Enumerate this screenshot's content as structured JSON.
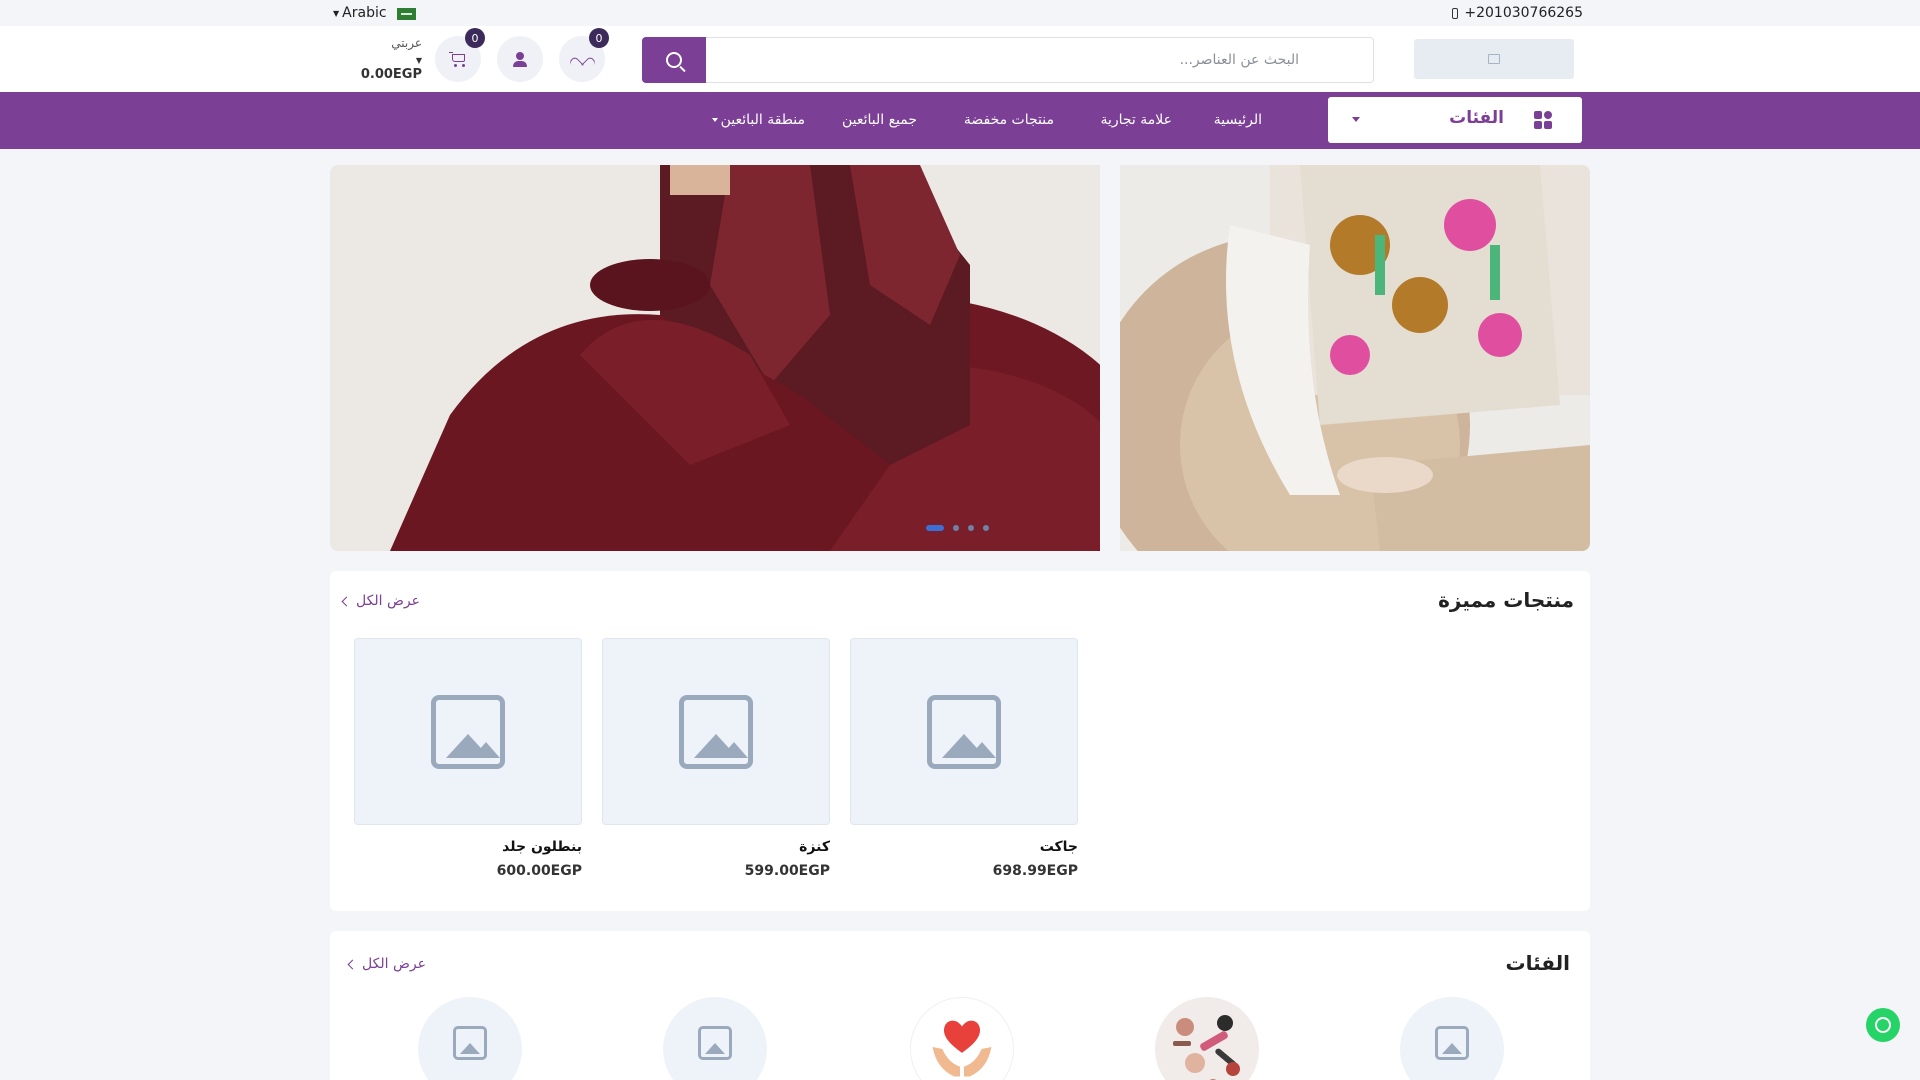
{
  "topbar": {
    "phone": "+201030766265",
    "language": "Arabic"
  },
  "header": {
    "search_placeholder": "البحث عن العناصر...",
    "wishlist_count": "0",
    "cart_count": "0",
    "cart_label": "عربتي",
    "cart_total": "0.00EGP"
  },
  "nav": {
    "categories_label": "الفئات",
    "links": [
      {
        "label": "الرئيسية"
      },
      {
        "label": "علامة تجارية"
      },
      {
        "label": "منتجات مخفضة"
      },
      {
        "label": "جميع البائعين"
      },
      {
        "label": "منطقة البائعين"
      }
    ]
  },
  "hero": {
    "slides": 4,
    "active_slide": 1
  },
  "featured": {
    "title": "منتجات مميزة",
    "view_all": "عرض الكل",
    "products": [
      {
        "name": "جاكت",
        "price": "698.99EGP"
      },
      {
        "name": "كنزة",
        "price": "599.00EGP"
      },
      {
        "name": "بنطلون جلد",
        "price": "600.00EGP"
      }
    ]
  },
  "categories": {
    "title": "الفئات",
    "view_all": "عرض الكل"
  },
  "colors": {
    "brand": "#7b3f95",
    "badge": "#3c2a5a",
    "whatsapp": "#25d366"
  }
}
